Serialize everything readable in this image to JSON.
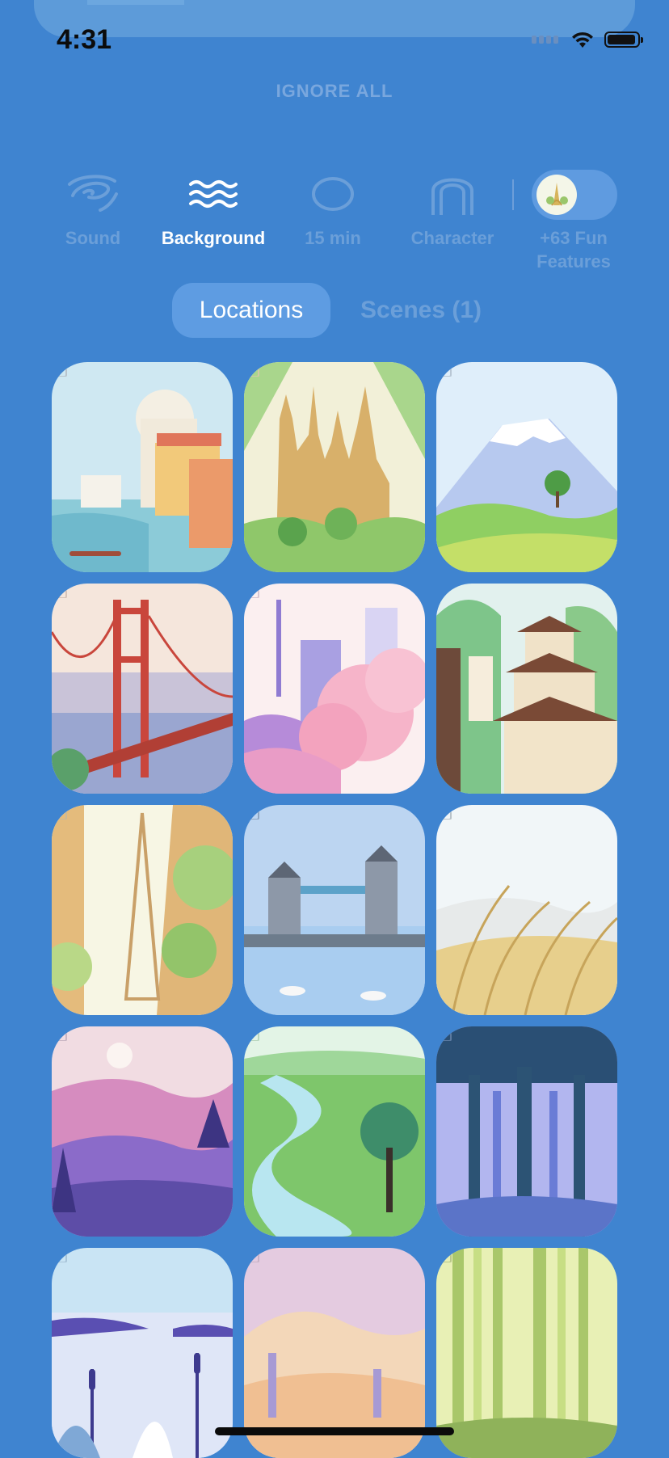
{
  "status_bar": {
    "time": "4:31"
  },
  "header": {
    "ignore_all": "IGNORE ALL"
  },
  "toolbar": {
    "items": [
      {
        "label": "Sound",
        "icon": "sound-wave-icon",
        "active": false
      },
      {
        "label": "Background",
        "icon": "waves-icon",
        "active": true
      },
      {
        "label": "15 min",
        "icon": "timer-circle-icon",
        "active": false
      },
      {
        "label": "Character",
        "icon": "character-icon",
        "active": false
      },
      {
        "label": "+63 Fun\nFeatures",
        "icon": "eiffel-tower-icon",
        "active": false
      }
    ]
  },
  "segments": {
    "locations": "Locations",
    "scenes": "Scenes (1)",
    "selected": "Locations"
  },
  "tiles": [
    {
      "name": "venice",
      "locked": true
    },
    {
      "name": "barcelona-sagrada-familia",
      "locked": true
    },
    {
      "name": "mount-fuji",
      "locked": true
    },
    {
      "name": "golden-gate-bridge",
      "locked": true
    },
    {
      "name": "tokyo-cherry-blossom",
      "locked": true
    },
    {
      "name": "japanese-pagoda",
      "locked": false
    },
    {
      "name": "eiffel-tower-street",
      "locked": true
    },
    {
      "name": "tower-bridge-london",
      "locked": true
    },
    {
      "name": "golden-grass-field",
      "locked": true
    },
    {
      "name": "purple-mountains",
      "locked": true
    },
    {
      "name": "green-river-valley",
      "locked": true
    },
    {
      "name": "blue-forest",
      "locked": true
    },
    {
      "name": "lake-cattails",
      "locked": true
    },
    {
      "name": "desert-dunes",
      "locked": true
    },
    {
      "name": "bamboo-forest",
      "locked": true
    }
  ],
  "colors": {
    "background": "#3f84d0",
    "active_text": "#ffffff",
    "inactive_text": "#6b9fd9"
  }
}
